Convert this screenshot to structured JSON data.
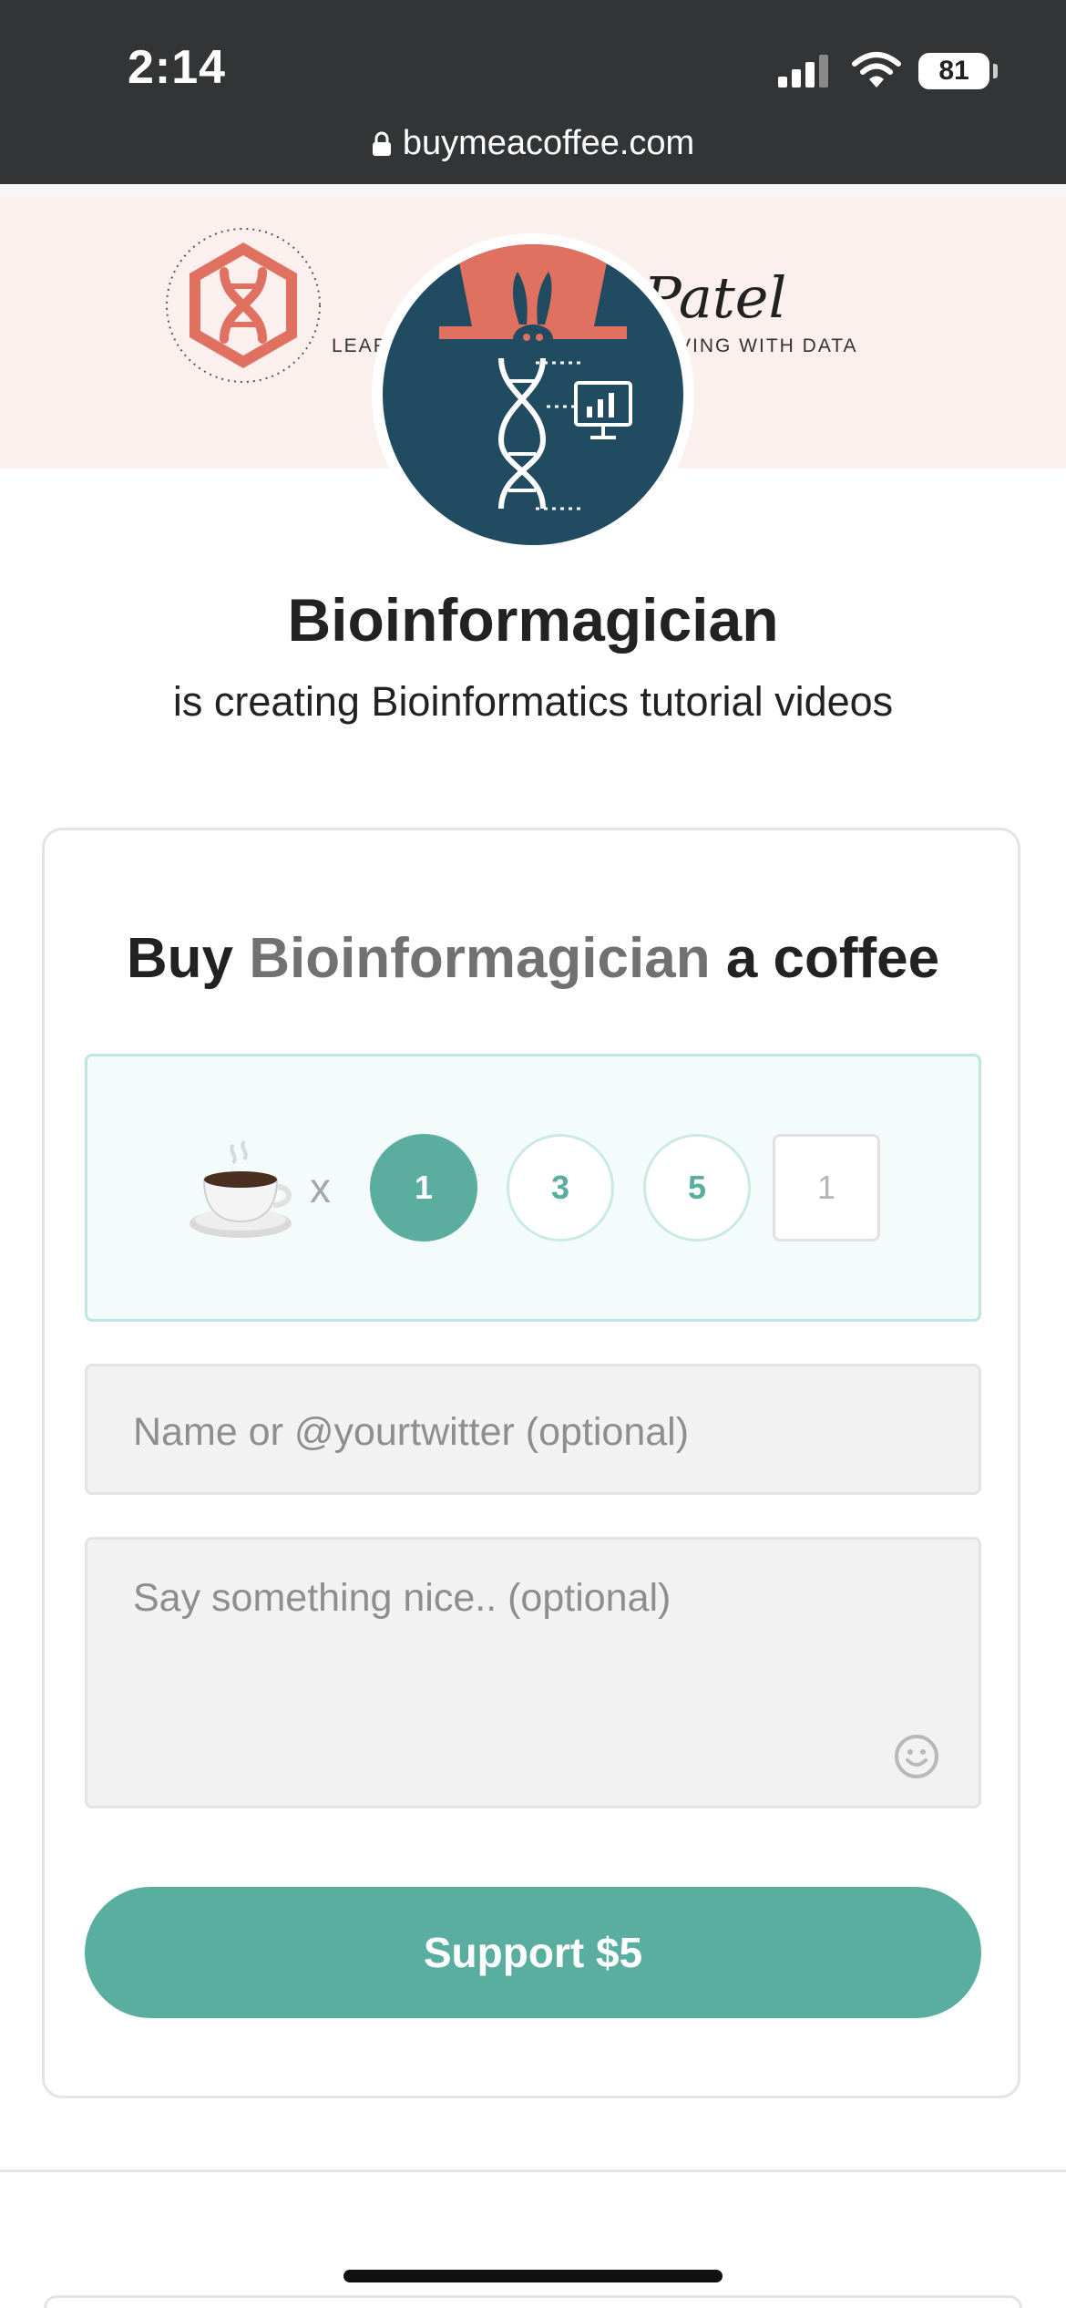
{
  "status_bar": {
    "time": "2:14",
    "battery": "81"
  },
  "browser": {
    "url": "buymeacoffee.com"
  },
  "cover": {
    "text_left": "LEAR",
    "text_right": "VING WITH DATA",
    "script_text": "Patel"
  },
  "creator": {
    "name": "Bioinformagician",
    "tagline": "is creating Bioinformatics tutorial videos"
  },
  "card": {
    "title_prefix": "Buy",
    "title_name": "Bioinformagician",
    "title_suffix": "a coffee",
    "cup_icon": "coffee-cup-icon",
    "multiplier": "x",
    "quantities": [
      "1",
      "3",
      "5"
    ],
    "selected_quantity": "1",
    "custom_quantity": "1",
    "name_placeholder": "Name or @yourtwitter (optional)",
    "message_placeholder": "Say something nice.. (optional)",
    "support_label": "Support $5"
  },
  "colors": {
    "accent": "#5aad9f",
    "chrome": "#333436",
    "cover_bg": "#fcf0ee",
    "avatar_bg": "#204b60",
    "logo_red": "#e07161"
  }
}
